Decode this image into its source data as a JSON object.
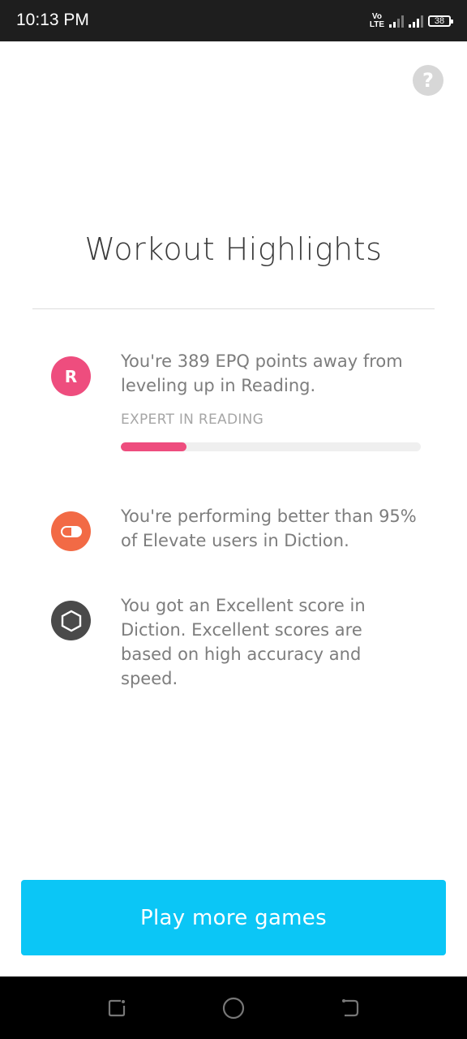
{
  "status_bar": {
    "time": "10:13 PM",
    "volte_top": "Vo",
    "volte_bottom": "LTE",
    "battery": "38"
  },
  "header": {
    "help_icon": "question-mark-icon",
    "help_label": "?"
  },
  "title": "Workout Highlights",
  "highlights": [
    {
      "icon": "reading-R-icon",
      "icon_letter": "R",
      "icon_color": "#ee4d7e",
      "text": "You're 389 EPQ points away from leveling up in Reading.",
      "level_label": "EXPERT IN READING",
      "progress": 0.22
    },
    {
      "icon": "diction-pill-icon",
      "icon_color": "#f26a45",
      "text": "You're performing better than 95% of Elevate users in Diction."
    },
    {
      "icon": "excellent-hexagon-icon",
      "icon_color": "#4a4a4a",
      "text": "You got an Excellent score in Diction. Excellent scores are based on high accuracy and speed."
    }
  ],
  "cta": {
    "label": "Play more games",
    "color": "#0bc6f6"
  },
  "nav": {
    "recent_icon": "recent-apps-icon",
    "home_icon": "home-circle-icon",
    "back_icon": "back-icon"
  }
}
